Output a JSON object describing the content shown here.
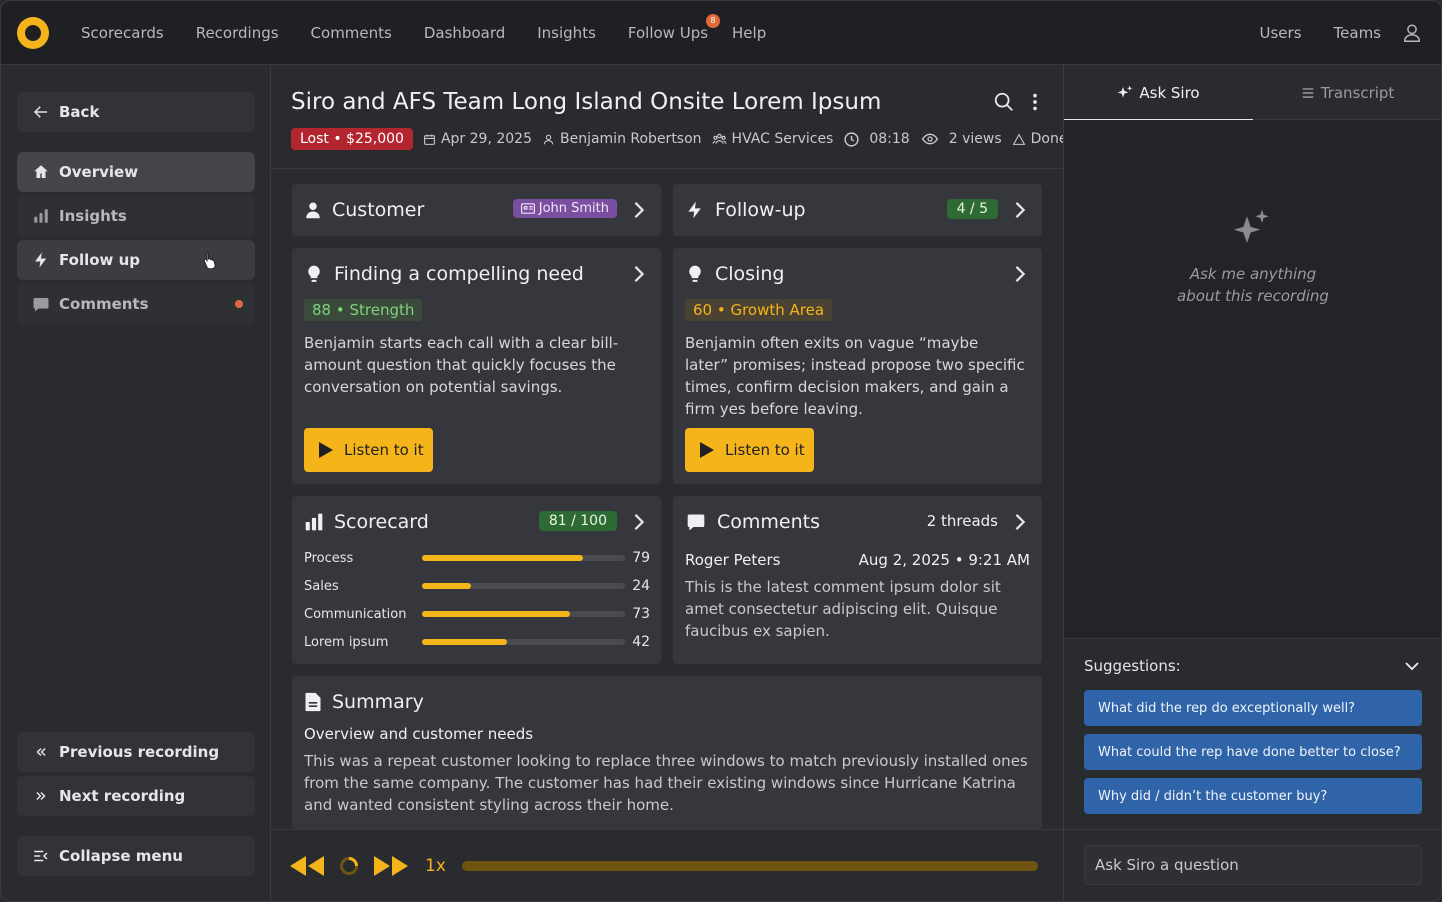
{
  "nav": {
    "items": [
      {
        "label": "Scorecards"
      },
      {
        "label": "Recordings"
      },
      {
        "label": "Comments"
      },
      {
        "label": "Dashboard"
      },
      {
        "label": "Insights"
      },
      {
        "label": "Follow Ups",
        "badge": "8"
      },
      {
        "label": "Help"
      }
    ],
    "right": [
      {
        "label": "Users"
      },
      {
        "label": "Teams"
      }
    ]
  },
  "sidebar": {
    "back": "Back",
    "items": [
      {
        "label": "Overview",
        "icon": "home-icon"
      },
      {
        "label": "Insights",
        "icon": "bar-chart-icon"
      },
      {
        "label": "Follow up",
        "icon": "bolt-icon"
      },
      {
        "label": "Comments",
        "icon": "comment-icon"
      }
    ],
    "previous": "Previous recording",
    "next": "Next recording",
    "collapse": "Collapse menu"
  },
  "header": {
    "title": "Siro and AFS Team Long Island Onsite Lorem Ipsum",
    "status": "Lost • $25,000",
    "date": "Apr 29, 2025",
    "rep": "Benjamin Robertson",
    "team": "HVAC Services",
    "duration": "08:18",
    "views": "2 views",
    "state": "Done"
  },
  "cards": {
    "customer": {
      "title": "Customer",
      "name": "John Smith"
    },
    "followup": {
      "title": "Follow-up",
      "count": "4 / 5"
    },
    "need": {
      "title": "Finding a compelling need",
      "tag": "88 • Strength",
      "text": "Benjamin starts each call with a clear bill-amount question that quickly focuses the conversation on potential savings.",
      "button": "Listen to it"
    },
    "closing": {
      "title": "Closing",
      "tag": "60 • Growth Area",
      "text": "Benjamin often exits on vague “maybe later” promises; instead propose two specific times, confirm decision makers, and gain a firm yes before leaving.",
      "button": "Listen to it"
    },
    "scorecard": {
      "title": "Scorecard",
      "score": "81 / 100",
      "rows": [
        {
          "label": "Process",
          "value": 79
        },
        {
          "label": "Sales",
          "value": 24
        },
        {
          "label": "Communication",
          "value": 73
        },
        {
          "label": "Lorem ipsum",
          "value": 42
        }
      ]
    },
    "comments": {
      "title": "Comments",
      "threads": "2 threads",
      "author": "Roger Peters",
      "date": "Aug 2, 2025 • 9:21 AM",
      "text": "This is the latest comment ipsum dolor sit amet consectetur adipiscing elit. Quisque faucibus ex sapien."
    },
    "summary": {
      "title": "Summary",
      "subtitle": "Overview and customer needs",
      "text": "This was a repeat customer looking to replace three windows to match previously installed ones from the same company. The customer has had their existing windows since Hurricane Katrina and wanted consistent styling across their home."
    }
  },
  "player": {
    "speed": "1x"
  },
  "right": {
    "tabs": [
      {
        "label": "Ask Siro"
      },
      {
        "label": "Transcript"
      }
    ],
    "empty_line1": "Ask me anything",
    "empty_line2": "about this recording",
    "suggestions_title": "Suggestions:",
    "suggestions": [
      "What did the rep do exceptionally well?",
      "What could the rep have done better to close?",
      "Why did / didn’t the customer buy?"
    ],
    "input_placeholder": "Ask Siro a question"
  },
  "colors": {
    "accent": "#f5b419",
    "danger": "#b3262f",
    "suggest": "#2f64a8"
  }
}
